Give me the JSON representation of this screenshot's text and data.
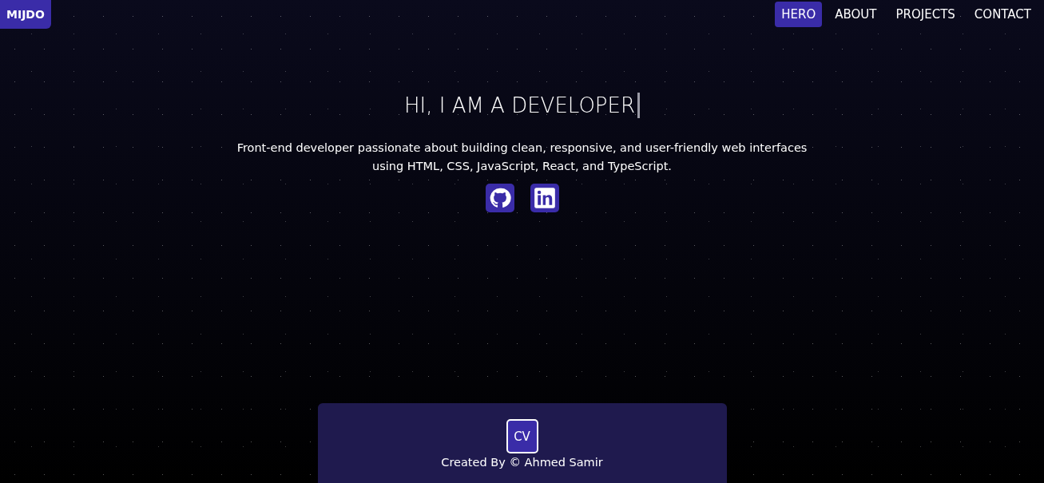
{
  "brand": "MIJDO",
  "nav": [
    {
      "label": "HERO",
      "selected": true
    },
    {
      "label": "ABOUT",
      "selected": false
    },
    {
      "label": "PROJECTS",
      "selected": false
    },
    {
      "label": "CONTACT",
      "selected": false
    }
  ],
  "hero": {
    "title": "HI, I AM A DEVELOPER",
    "description": "Front-end developer passionate about building clean, responsive, and user-friendly web interfaces using HTML, CSS, JavaScript, React, and TypeScript.",
    "social": [
      {
        "kind": "github"
      },
      {
        "kind": "linkedin"
      }
    ]
  },
  "footer": {
    "cv_button": "CV",
    "credit": "Created By © Ahmed Samir"
  }
}
